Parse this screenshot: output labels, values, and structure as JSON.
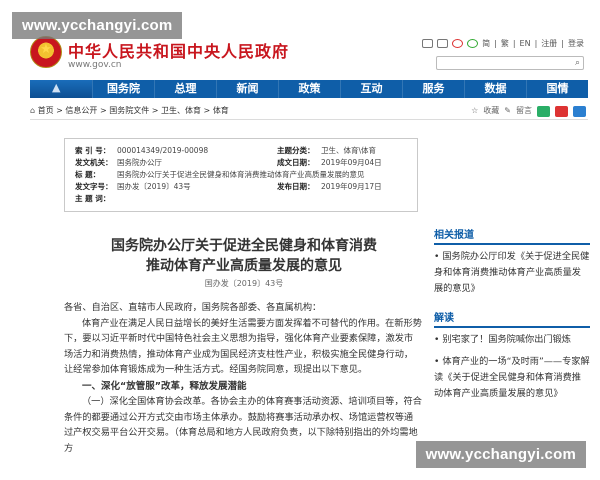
{
  "watermark": "www.ycchangyi.com",
  "header": {
    "site_title": "中华人民共和国中央人民政府",
    "site_url": "www.gov.cn",
    "top_links": [
      "简",
      "繁",
      "EN",
      "注册",
      "登录"
    ]
  },
  "nav": {
    "items": [
      "国务院",
      "总理",
      "新闻",
      "政策",
      "互动",
      "服务",
      "数据",
      "国情"
    ]
  },
  "breadcrumb": {
    "home": "首页",
    "path": [
      "信息公开",
      "国务院文件",
      "卫生、体育",
      "体育"
    ],
    "fav": "收藏",
    "print": "留言"
  },
  "meta": {
    "index_no_label": "索 引 号：",
    "index_no": "000014349/2019-00098",
    "topic_label": "主题分类：",
    "topic": "卫生、体育\\体育",
    "issuer_label": "发文机关：",
    "issuer": "国务院办公厅",
    "written_label": "成文日期：",
    "written": "2019年09月04日",
    "title_label": "标 题：",
    "title": "国务院办公厅关于促进全民健身和体育消费推动体育产业高质量发展的意见",
    "doc_no_label": "发文字号：",
    "doc_no": "国办发〔2019〕43号",
    "publish_label": "发布日期：",
    "publish": "2019年09月17日",
    "subject_label": "主 题 词："
  },
  "doc": {
    "title_line1": "国务院办公厅关于促进全民健身和体育消费",
    "title_line2": "推动体育产业高质量发展的意见",
    "number": "国办发〔2019〕43号",
    "salutation": "各省、自治区、直辖市人民政府，国务院各部委、各直属机构：",
    "para1": "体育产业在满足人民日益增长的美好生活需要方面发挥着不可替代的作用。在新形势下，要以习近平新时代中国特色社会主义思想为指导，强化体育产业要素保障，激发市场活力和消费热情，推动体育产业成为国民经济支柱性产业，积极实施全民健身行动，让经常参加体育锻炼成为一种生活方式。经国务院同意，现提出以下意见。",
    "heading1": "一、深化“放管服”改革，释放发展潜能",
    "para2": "（一）深化全国体育协会改革。各协会主办的体育赛事活动资源、培训项目等，符合条件的都要通过公开方式交由市场主体承办。鼓励将赛事活动承办权、场馆运营权等通过产权交易平台公开交易。（体育总局和地方人民政府负责，以下除特别指出的外均需地方"
  },
  "sidebar": {
    "related_heading": "相关报道",
    "related": [
      "国务院办公厅印发《关于促进全民健身和体育消费推动体育产业高质量发展的意见》"
    ],
    "interp_heading": "解读",
    "interp": [
      "别宅家了！国务院喊你出门锻炼",
      "体育产业的一场“及时雨”——专家解读《关于促进全民健身和体育消费推动体育产业高质量发展的意见》"
    ]
  },
  "colors": {
    "brand_red": "#c8161e",
    "nav_blue": "#0f5ea8"
  }
}
